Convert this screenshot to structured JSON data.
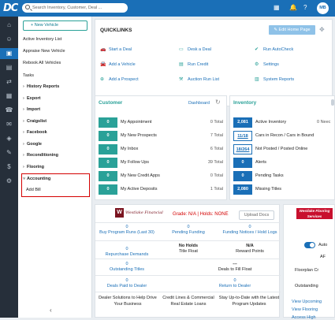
{
  "topbar": {
    "logo": "DC",
    "search_placeholder": "Search Inventory, Customer, Deal ...",
    "avatar": "MB"
  },
  "sidebar": {
    "new_vehicle": "New Vehicle",
    "items": [
      {
        "label": "Active Inventory List",
        "chevron": false,
        "bold": false
      },
      {
        "label": "Appraise New Vehicle",
        "chevron": false,
        "bold": false
      },
      {
        "label": "Rebook All Vehicles",
        "chevron": false,
        "bold": false
      },
      {
        "label": "Tasks",
        "chevron": false,
        "bold": false
      },
      {
        "label": "History Reports",
        "chevron": true,
        "bold": true
      },
      {
        "label": "Export",
        "chevron": true,
        "bold": true
      },
      {
        "label": "Import",
        "chevron": true,
        "bold": true
      },
      {
        "label": "Craigslist",
        "chevron": true,
        "bold": true
      },
      {
        "label": "Facebook",
        "chevron": true,
        "bold": true
      },
      {
        "label": "Google",
        "chevron": true,
        "bold": true
      },
      {
        "label": "Reconditioning",
        "chevron": true,
        "bold": true
      },
      {
        "label": "Flooring",
        "chevron": true,
        "bold": true
      },
      {
        "label": "Accounting",
        "chevron": true,
        "bold": true
      },
      {
        "label": "Add Bill",
        "chevron": false,
        "bold": false
      }
    ]
  },
  "quicklinks": {
    "title": "QUICKLINKS",
    "edit_button": "Edit Home Page",
    "links": [
      [
        "Start a Deal",
        "Desk a Deal",
        "Run AutoCheck"
      ],
      [
        "Add a Vehicle",
        "Run Credit",
        "Settings"
      ],
      [
        "Add a Prospect",
        "Auction Run List",
        "System Reports"
      ]
    ]
  },
  "customer": {
    "title": "Customer",
    "dashboard_link": "Dashboard",
    "rows": [
      {
        "count": "0",
        "label": "My Appointment",
        "total": "0 Total"
      },
      {
        "count": "0",
        "label": "My New Prospects",
        "total": "7 Total"
      },
      {
        "count": "0",
        "label": "My Inbox",
        "total": "6 Total"
      },
      {
        "count": "0",
        "label": "My Follow Ups",
        "total": "39 Total"
      },
      {
        "count": "0",
        "label": "My New Credit Apps",
        "total": "0 Total"
      },
      {
        "count": "0",
        "label": "My Active Deposits",
        "total": "1 Total"
      }
    ]
  },
  "inventory": {
    "title": "Inventory",
    "rows": [
      {
        "count": "2,081",
        "label": "Active Inventory",
        "extra": "0 Neec"
      },
      {
        "count": "11/18",
        "label": "Cars in Recon / Cars in Bound",
        "extra": ""
      },
      {
        "count": "18/264",
        "label": "Not Posted / Posted Online",
        "extra": ""
      },
      {
        "count": "0",
        "label": "Alerts",
        "extra": ""
      },
      {
        "count": "0",
        "label": "Pending Tasks",
        "extra": ""
      },
      {
        "count": "2,080",
        "label": "Missing Titles",
        "extra": ""
      }
    ]
  },
  "westlake": {
    "logo_text": "Westlake Financial",
    "grade": "Grade: N/A | Holds: NONE",
    "upload_docs": "Upload Docs",
    "stats": [
      [
        {
          "value": "0",
          "label": "Buy Program Runs (Last 30)",
          "dark": false
        },
        {
          "value": "0",
          "label": "Pending Funding",
          "dark": false
        },
        {
          "value": "0",
          "label": "Funding Notices / Hold Logs",
          "dark": false
        }
      ],
      [
        {
          "value": "0",
          "label": "Repurchase Demands",
          "dark": false
        },
        {
          "value": "No Holds",
          "label": "Title Float",
          "dark": true
        },
        {
          "value": "N/A",
          "label": "Reward Points",
          "dark": true
        }
      ],
      [
        {
          "value": "0",
          "label": "Outstanding Titles",
          "dark": false
        },
        {
          "value": "---",
          "label": "Deals to Fill Float",
          "dark": true
        },
        {
          "value": "",
          "label": "",
          "dark": false
        }
      ],
      [
        {
          "value": "0",
          "label": "Deals Paid to Dealer",
          "dark": false
        },
        {
          "value": "0",
          "label": "Return to Dealer",
          "dark": false
        },
        {
          "value": "",
          "label": "",
          "dark": false
        }
      ]
    ],
    "footer": [
      "Dealer Solutions to Help Drive Your Business",
      "Credit Lines & Commercial Real Estate Loans",
      "Stay Up-to-Date with the Latest Program Updates"
    ]
  },
  "flooring": {
    "logo_text": "Westlake Flooring Services",
    "toggle_label": "Auto",
    "lines": [
      {
        "text": "AF",
        "link": false
      },
      {
        "text": "Floorplan Cr",
        "link": false
      },
      {
        "text": "Outstanding",
        "link": false
      },
      {
        "text": "View Upcoming",
        "link": true
      },
      {
        "text": "View Flooring",
        "link": true
      },
      {
        "text": "Access High",
        "link": true
      }
    ]
  }
}
